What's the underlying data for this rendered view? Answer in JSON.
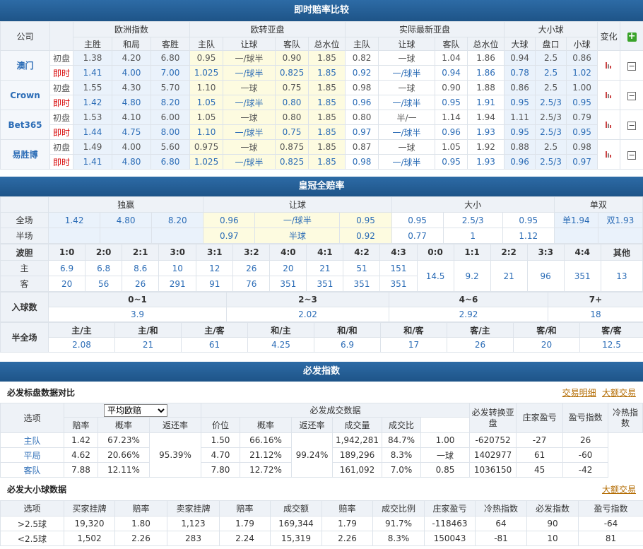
{
  "sec1": {
    "title": "即时赔率比较",
    "h_company": "公司",
    "h_change": "变化",
    "groups": [
      "欧洲指数",
      "欧转亚盘",
      "实际最新亚盘",
      "大小球"
    ],
    "subs": [
      "主胜",
      "和局",
      "客胜",
      "主队",
      "让球",
      "客队",
      "总水位",
      "主队",
      "让球",
      "客队",
      "总水位",
      "大球",
      "盘口",
      "小球"
    ],
    "companies": [
      {
        "name": "澳门",
        "rows": [
          {
            "type": "初盘",
            "v": [
              "1.38",
              "4.20",
              "6.80",
              "0.95",
              "一/球半",
              "0.90",
              "1.85",
              "0.82",
              "一球",
              "1.04",
              "1.86",
              "0.94",
              "2.5",
              "0.86"
            ]
          },
          {
            "type": "即时",
            "v": [
              "1.41",
              "4.00",
              "7.00",
              "1.025",
              "一/球半",
              "0.825",
              "1.85",
              "0.92",
              "一/球半",
              "0.94",
              "1.86",
              "0.78",
              "2.5",
              "1.02"
            ]
          }
        ]
      },
      {
        "name": "Crown",
        "rows": [
          {
            "type": "初盘",
            "v": [
              "1.55",
              "4.30",
              "5.70",
              "1.10",
              "一球",
              "0.75",
              "1.85",
              "0.98",
              "一球",
              "0.90",
              "1.88",
              "0.86",
              "2.5",
              "1.00"
            ]
          },
          {
            "type": "即时",
            "v": [
              "1.42",
              "4.80",
              "8.20",
              "1.05",
              "一/球半",
              "0.80",
              "1.85",
              "0.96",
              "一/球半",
              "0.95",
              "1.91",
              "0.95",
              "2.5/3",
              "0.95"
            ]
          }
        ]
      },
      {
        "name": "Bet365",
        "rows": [
          {
            "type": "初盘",
            "v": [
              "1.53",
              "4.10",
              "6.00",
              "1.05",
              "一球",
              "0.80",
              "1.85",
              "0.80",
              "半/一",
              "1.14",
              "1.94",
              "1.11",
              "2.5/3",
              "0.79"
            ]
          },
          {
            "type": "即时",
            "v": [
              "1.44",
              "4.75",
              "8.00",
              "1.10",
              "一/球半",
              "0.75",
              "1.85",
              "0.97",
              "一/球半",
              "0.96",
              "1.93",
              "0.95",
              "2.5/3",
              "0.95"
            ]
          }
        ]
      },
      {
        "name": "易胜博",
        "rows": [
          {
            "type": "初盘",
            "v": [
              "1.49",
              "4.00",
              "5.60",
              "0.975",
              "一球",
              "0.875",
              "1.85",
              "0.87",
              "一球",
              "1.05",
              "1.92",
              "0.88",
              "2.5",
              "0.98"
            ]
          },
          {
            "type": "即时",
            "v": [
              "1.41",
              "4.80",
              "6.80",
              "1.025",
              "一/球半",
              "0.825",
              "1.85",
              "0.98",
              "一/球半",
              "0.95",
              "1.93",
              "0.96",
              "2.5/3",
              "0.97"
            ]
          }
        ]
      }
    ]
  },
  "sec2": {
    "title": "皇冠全赔率",
    "groups": [
      "独赢",
      "让球",
      "大小",
      "单双"
    ],
    "full_label": "全场",
    "half_label": "半场",
    "full": [
      "1.42",
      "4.80",
      "8.20",
      "0.96",
      "一/球半",
      "0.95",
      "0.95",
      "2.5/3",
      "0.95",
      "单1.94",
      "双1.93"
    ],
    "half": [
      "",
      "",
      "",
      "0.97",
      "半球",
      "0.92",
      "0.77",
      "1",
      "1.12",
      "",
      ""
    ],
    "cs_label": "波胆",
    "cs_headers": [
      "1:0",
      "2:0",
      "2:1",
      "3:0",
      "3:1",
      "3:2",
      "4:0",
      "4:1",
      "4:2",
      "4:3",
      "0:0",
      "1:1",
      "2:2",
      "3:3",
      "4:4",
      "其他"
    ],
    "home_label": "主",
    "away_label": "客",
    "cs_home": [
      "6.9",
      "6.8",
      "8.6",
      "10",
      "12",
      "26",
      "20",
      "21",
      "51",
      "151"
    ],
    "cs_away": [
      "20",
      "56",
      "26",
      "291",
      "91",
      "76",
      "351",
      "351",
      "351",
      "351"
    ],
    "cs_draw": [
      "14.5",
      "9.2",
      "21",
      "96",
      "351",
      "13"
    ],
    "goals_label": "入球数",
    "goals_headers": [
      "0~1",
      "2~3",
      "4~6",
      "7+"
    ],
    "goals_values": [
      "3.9",
      "2.02",
      "2.92",
      "18"
    ],
    "htft_label": "半全场",
    "htft_headers": [
      "主/主",
      "主/和",
      "主/客",
      "和/主",
      "和/和",
      "和/客",
      "客/主",
      "客/和",
      "客/客"
    ],
    "htft_values": [
      "2.08",
      "21",
      "61",
      "4.25",
      "6.9",
      "17",
      "26",
      "20",
      "12.5"
    ]
  },
  "sec3": {
    "title": "必发指数",
    "sub1": "必发标盘数据对比",
    "link1": "交易明细",
    "link2": "大额交易",
    "h_option": "选项",
    "select_value": "平均欧赔",
    "h_odds": "赔率",
    "h_prob": "概率",
    "h_return": "返还率",
    "h_betfair": "必发成交数据",
    "h_price": "价位",
    "h_prob2": "概率",
    "h_return2": "返还率",
    "h_volume": "成交量",
    "h_ratio": "成交比",
    "h_asian": "必发转换亚盘",
    "h_banker": "庄家盈亏",
    "h_pl": "盈亏指数",
    "h_hot": "冷热指数",
    "rows": [
      {
        "opt": "主队",
        "odds": "1.42",
        "prob": "67.23%",
        "price": "1.50",
        "prob2": "66.16%",
        "vol": "1,942,281",
        "ratio": "84.7%",
        "asian": "1.00",
        "banker": "-620752",
        "pl": "-27",
        "hot": "26"
      },
      {
        "opt": "平局",
        "odds": "4.62",
        "prob": "20.66%",
        "price": "4.70",
        "prob2": "21.12%",
        "vol": "189,296",
        "ratio": "8.3%",
        "asian": "一球",
        "banker": "1402977",
        "pl": "61",
        "hot": "-60"
      },
      {
        "opt": "客队",
        "odds": "7.88",
        "prob": "12.11%",
        "price": "7.80",
        "prob2": "12.72%",
        "vol": "161,092",
        "ratio": "7.0%",
        "asian": "0.85",
        "banker": "1036150",
        "pl": "45",
        "hot": "-42"
      }
    ],
    "return1": "95.39%",
    "return2": "99.24%",
    "sub2": "必发大小球数据",
    "link3": "大额交易",
    "ou_headers": [
      "选项",
      "买家挂牌",
      "赔率",
      "卖家挂牌",
      "赔率",
      "成交额",
      "赔率",
      "成交比例",
      "庄家盈亏",
      "冷热指数",
      "必发指数",
      "盈亏指数"
    ],
    "ou_rows": [
      [
        ">2.5球",
        "19,320",
        "1.80",
        "1,123",
        "1.79",
        "169,344",
        "1.79",
        "91.7%",
        "-118463",
        "64",
        "90",
        "-64"
      ],
      [
        "<2.5球",
        "1,502",
        "2.26",
        "283",
        "2.24",
        "15,319",
        "2.26",
        "8.3%",
        "150043",
        "-81",
        "10",
        "81"
      ]
    ]
  }
}
